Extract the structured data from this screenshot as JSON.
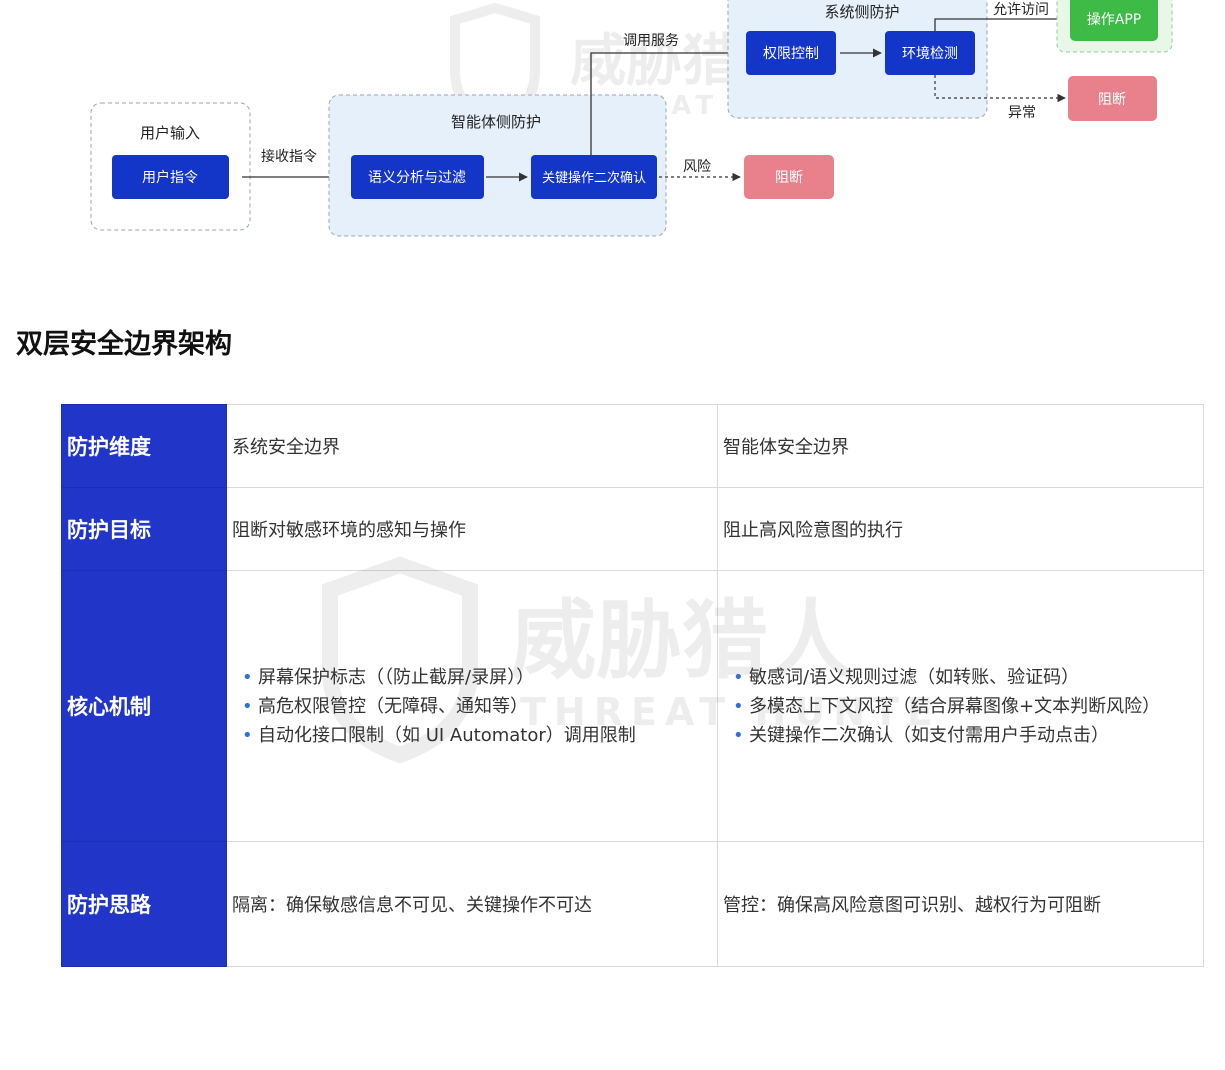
{
  "diagram": {
    "user_input": {
      "title": "用户输入",
      "node": "用户指令"
    },
    "edge_receive": "接收指令",
    "agent_side": {
      "title": "智能体侧防护",
      "node_semantic": "语义分析与过滤",
      "node_confirm": "关键操作二次确认"
    },
    "edge_risk": "风险",
    "block_1": "阻断",
    "edge_call": "调用服务",
    "system_side": {
      "title": "系统侧防护",
      "node_permission": "权限控制",
      "node_env": "环境检测"
    },
    "edge_allow": "允许访问",
    "app_node": "操作APP",
    "edge_abnormal": "异常",
    "block_2": "阻断",
    "watermark": {
      "cn": "威胁猎人",
      "en": "THREAT HUNTER"
    }
  },
  "section_title": "双层安全边界架构",
  "table": {
    "rows": [
      {
        "header": "防护维度",
        "col1": "系统安全边界",
        "col2": "智能体安全边界"
      },
      {
        "header": "防护目标",
        "col1": "阻断对敏感环境的感知与操作",
        "col2": "阻止高风险意图的执行"
      },
      {
        "header": "核心机制",
        "col1_items": [
          "屏幕保护标志（（防止截屏/录屏））",
          "高危权限管控（无障碍、通知等）",
          "自动化接口限制（如 UI Automator）调用限制"
        ],
        "col2_items": [
          "敏感词/语义规则过滤（如转账、验证码）",
          "多模态上下文风控（结合屏幕图像+文本判断风险）",
          "关键操作二次确认（如支付需用户手动点击）"
        ]
      },
      {
        "header": "防护思路",
        "col1": "隔离：确保敏感信息不可见、关键操作不可达",
        "col2": "管控：确保高风险意图可识别、越权行为可阻断"
      }
    ]
  },
  "colors": {
    "node_blue": "#1436c8",
    "group_fill": "#e6f0fb",
    "block_pink": "#e8818c",
    "app_green": "#3dbb46",
    "header_blue": "#2136c9"
  }
}
